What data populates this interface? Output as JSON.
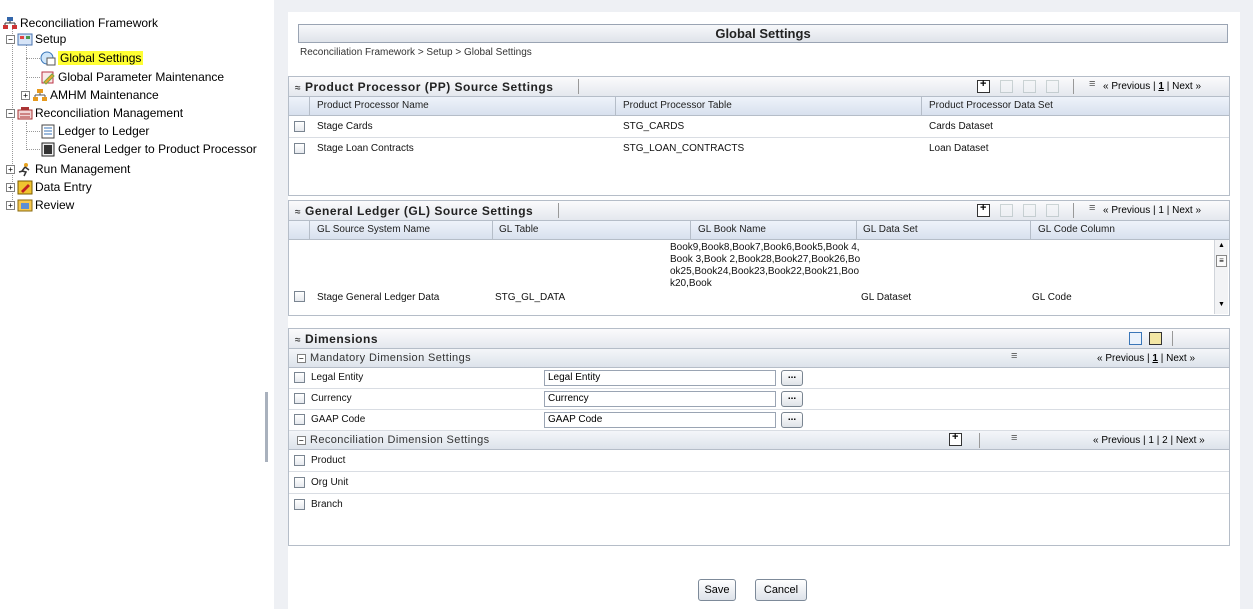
{
  "tree": {
    "root": "Reconciliation Framework",
    "setup": "Setup",
    "global_settings": "Global Settings",
    "global_param": "Global Parameter Maintenance",
    "amhm": "AMHM Maintenance",
    "recon_mgmt": "Reconciliation Management",
    "ledger_to_ledger": "Ledger to Ledger",
    "gl_to_pp": "General Ledger to Product Processor",
    "run_mgmt": "Run Management",
    "data_entry": "Data Entry",
    "review": "Review"
  },
  "page": {
    "title": "Global Settings",
    "breadcrumb": "Reconciliation Framework > Setup > Global Settings"
  },
  "pp": {
    "title": "Product Processor (PP) Source Settings",
    "pager": {
      "prev": "« Previous",
      "sep1": " | ",
      "page": "1",
      "sep2": " | ",
      "next": "Next »"
    },
    "columns": [
      "Product Processor Name",
      "Product Processor Table",
      "Product Processor Data Set"
    ],
    "rows": [
      [
        "Stage Cards",
        "STG_CARDS",
        "Cards Dataset"
      ],
      [
        "Stage Loan Contracts",
        "STG_LOAN_CONTRACTS",
        "Loan Dataset"
      ]
    ]
  },
  "gl": {
    "title": "General Ledger (GL) Source Settings",
    "pager": {
      "prev": "« Previous",
      "sep1": " | ",
      "page": "1",
      "sep2": " | ",
      "next": "Next »"
    },
    "columns": [
      "GL Source System Name",
      "GL Table",
      "GL Book Name",
      "GL Data Set",
      "GL Code Column"
    ],
    "rows": [
      [
        "Stage General Ledger Data",
        "STG_GL_DATA",
        "Book9,Book8,Book7,Book6,Book5,Book 4,Book 3,Book 2,Book28,Book27,Book26,Book25,Book24,Book23,Book22,Book21,Book20,Book",
        "GL Dataset",
        "GL Code"
      ]
    ]
  },
  "dim": {
    "title": "Dimensions",
    "mandatory_title": "Mandatory Dimension Settings",
    "mandatory_pager": {
      "prev": "« Previous",
      "sep1": " | ",
      "page": "1",
      "sep2": " | ",
      "next": "Next »"
    },
    "mandatory": [
      {
        "name": "Legal Entity",
        "value": "Legal Entity"
      },
      {
        "name": "Currency",
        "value": "Currency"
      },
      {
        "name": "GAAP Code",
        "value": "GAAP Code"
      }
    ],
    "dots": "...",
    "recon_title": "Reconciliation Dimension Settings",
    "recon_pager": "« Previous | 1 | 2 | Next »",
    "recon": [
      "Product",
      "Org Unit",
      "Branch"
    ]
  },
  "buttons": {
    "save": "Save",
    "cancel": "Cancel"
  },
  "colors": {
    "selected_highlight": "#ffff33",
    "panel_border": "#b5bdc8",
    "header_blue": "#d8e1ee"
  }
}
